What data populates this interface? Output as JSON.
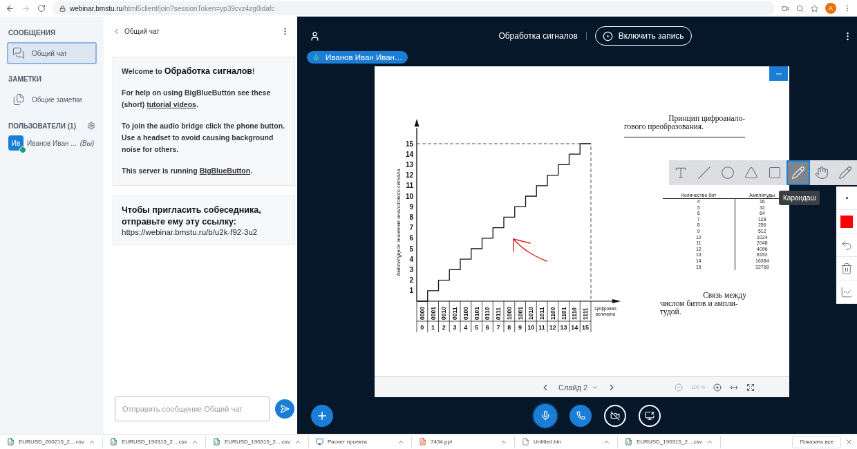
{
  "browser": {
    "url_host": "webinar.bmstu.ru",
    "url_path": "/html5client/join?sessionToken=yp39cvz4zg0idafc",
    "profile_initial": "A"
  },
  "sidebar": {
    "sections": [
      {
        "title": "СООБЩЕНИЯ",
        "items": [
          {
            "label": "Общий чат",
            "kind": "chat",
            "selected": true
          }
        ]
      },
      {
        "title": "ЗАМЕТКИ",
        "items": [
          {
            "label": "Общие заметки",
            "kind": "notes",
            "selected": false
          }
        ]
      }
    ],
    "users_title": "ПОЛЬЗОВАТЕЛИ (1)",
    "users": [
      {
        "initials": "Ив",
        "name": "Иванов Иван ...",
        "suffix": "(Вы)"
      }
    ]
  },
  "chat": {
    "title": "Общий чат",
    "messages": [
      {
        "kind": "welcome",
        "paragraphs": [
          [
            {
              "kind": "text",
              "text": "Welcome to **Обработка сигналов**!"
            }
          ],
          [
            {
              "kind": "text",
              "text": "For help on using BigBlueButton see these (short) "
            },
            {
              "kind": "link",
              "text": "tutorial videos"
            },
            {
              "kind": "text",
              "text": "."
            }
          ],
          [
            {
              "kind": "text",
              "text": "To join the audio bridge click the phone button. Use a headset to avoid causing background noise for others."
            }
          ],
          [
            {
              "kind": "text",
              "text": "This server is running "
            },
            {
              "kind": "link",
              "text": "BigBlueButton"
            },
            {
              "kind": "text",
              "text": "."
            }
          ]
        ]
      },
      {
        "kind": "invite",
        "heading": "Чтобы пригласить собеседника, отправьте ему эту ссылку:",
        "url": "https://webinar.bmstu.ru/b/u2k-f92-3u2"
      }
    ],
    "input": {
      "placeholder": "Отправить сообщение Общий чат"
    }
  },
  "presentation": {
    "meeting_title": "Обработка сигналов",
    "record_label": "Включить запись",
    "talker": "Иванов Иван Иван…",
    "slide": {
      "chart_data": {
        "type": "line",
        "ylabel": "Амплитудное значение аналогового сигнала",
        "xlabel": "Цифровая величина",
        "x": [
          -0.5,
          0.5,
          0.5,
          1.5,
          1.5,
          2.5,
          2.5,
          3.5,
          3.5,
          4.5,
          4.5,
          5.5,
          5.5,
          6.5,
          6.5,
          7.5,
          7.5,
          8.5,
          8.5,
          9.5,
          9.5,
          10.5,
          10.5,
          11.5,
          11.5,
          12.5,
          12.5,
          13.5,
          13.5,
          14.5,
          14.5,
          15.5
        ],
        "values": [
          0,
          0,
          1,
          1,
          2,
          2,
          3,
          3,
          4,
          4,
          5,
          5,
          6,
          6,
          7,
          7,
          8,
          8,
          9,
          9,
          10,
          10,
          11,
          11,
          12,
          12,
          13,
          13,
          14,
          14,
          15,
          15
        ],
        "yticks": [
          1,
          2,
          3,
          4,
          5,
          6,
          7,
          8,
          9,
          10,
          11,
          12,
          13,
          14,
          15
        ],
        "xticks": [
          0,
          1,
          2,
          3,
          4,
          5,
          6,
          7,
          8,
          9,
          10,
          11,
          12,
          13,
          14,
          15
        ],
        "xlim": [
          -0.5,
          15.5
        ],
        "ylim": [
          0,
          16.5
        ]
      },
      "binary_codes": [
        "0000",
        "0001",
        "0010",
        "0011",
        "0100",
        "0101",
        "0110",
        "0111",
        "1000",
        "1001",
        "1010",
        "1011",
        "1100",
        "1101",
        "1110",
        "1111"
      ],
      "caption_top": [
        "Принцип цифроанало-",
        "гового преобразования."
      ],
      "table": {
        "columns": [
          "Количество бит",
          "Амплитуды"
        ],
        "rows": [
          [
            "4",
            "16"
          ],
          [
            "5",
            "32"
          ],
          [
            "6",
            "64"
          ],
          [
            "7",
            "128"
          ],
          [
            "8",
            "256"
          ],
          [
            "9",
            "512"
          ],
          [
            "10",
            "1024"
          ],
          [
            "11",
            "2048"
          ],
          [
            "12",
            "4096"
          ],
          [
            "13",
            "8192"
          ],
          [
            "14",
            "16384"
          ],
          [
            "15",
            "32768"
          ]
        ]
      },
      "caption_bottom": [
        "Связь между",
        "числом битов и ампли-",
        "тудой."
      ]
    },
    "nav": {
      "slide_label": "Слайд 2",
      "zoom": "100 %"
    },
    "tools": [
      {
        "kind": "text",
        "selected": false
      },
      {
        "kind": "line",
        "selected": false
      },
      {
        "kind": "ellipse",
        "selected": false
      },
      {
        "kind": "triangle",
        "selected": false
      },
      {
        "kind": "rectangle",
        "selected": false
      },
      {
        "kind": "pencil",
        "selected": true
      },
      {
        "kind": "hand",
        "selected": false
      },
      {
        "kind": "pencil",
        "selected": false
      }
    ],
    "tooltip": "Карандаш",
    "side_tools": [
      {
        "kind": "thickness"
      },
      {
        "kind": "color",
        "color": "#ff0000"
      },
      {
        "kind": "undo"
      },
      {
        "kind": "clear"
      },
      {
        "kind": "multiuser"
      }
    ]
  },
  "downloads": {
    "items": [
      {
        "name": "EURUSD_200215_2....csv",
        "kind": "csv"
      },
      {
        "name": "EURUSD_190315_2....csv",
        "kind": "csv"
      },
      {
        "name": "EURUSD_190315_2....csv",
        "kind": "csv"
      },
      {
        "name": "Расчет проекта",
        "kind": "app"
      },
      {
        "name": "7434.ppt",
        "kind": "ppt"
      },
      {
        "name": "Untitled.bin",
        "kind": "bin"
      },
      {
        "name": "EURUSD_190315_2....csv",
        "kind": "csv"
      }
    ],
    "show_all": "Показать все"
  }
}
